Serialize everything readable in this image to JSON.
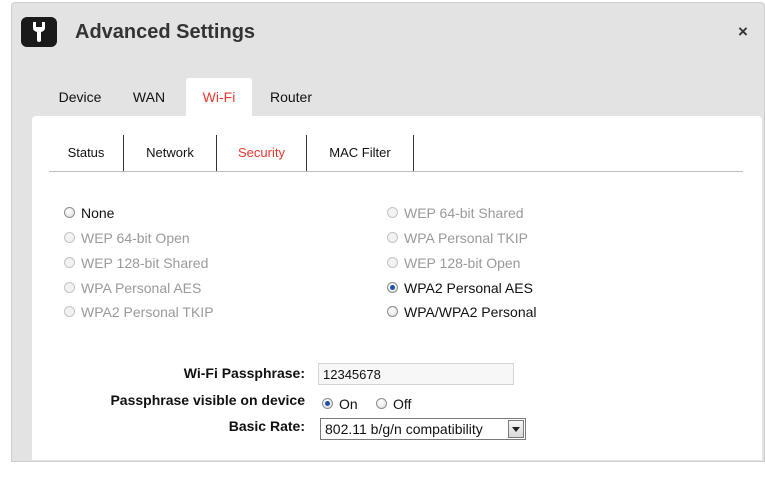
{
  "window": {
    "title": "Advanced Settings",
    "close_label": "×"
  },
  "icons": {
    "app": "wrench-icon",
    "close": "close-icon",
    "dropdown": "chevron-down-icon"
  },
  "main_tabs": [
    {
      "label": "Device",
      "active": false
    },
    {
      "label": "WAN",
      "active": false
    },
    {
      "label": "Wi-Fi",
      "active": true
    },
    {
      "label": "Router",
      "active": false
    }
  ],
  "sub_tabs": [
    {
      "label": "Status",
      "active": false
    },
    {
      "label": "Network",
      "active": false
    },
    {
      "label": "Security",
      "active": true
    },
    {
      "label": "MAC Filter",
      "active": false
    }
  ],
  "security_options": {
    "left": [
      {
        "label": "None",
        "enabled": true,
        "checked": false
      },
      {
        "label": "WEP 64-bit Open",
        "enabled": false,
        "checked": false
      },
      {
        "label": "WEP 128-bit Shared",
        "enabled": false,
        "checked": false
      },
      {
        "label": "WPA Personal AES",
        "enabled": false,
        "checked": false
      },
      {
        "label": "WPA2 Personal TKIP",
        "enabled": false,
        "checked": false
      }
    ],
    "right": [
      {
        "label": "WEP 64-bit Shared",
        "enabled": false,
        "checked": false
      },
      {
        "label": "WPA Personal TKIP",
        "enabled": false,
        "checked": false
      },
      {
        "label": "WEP 128-bit Open",
        "enabled": false,
        "checked": false
      },
      {
        "label": "WPA2 Personal AES",
        "enabled": true,
        "checked": true
      },
      {
        "label": "WPA/WPA2 Personal",
        "enabled": true,
        "checked": false
      }
    ]
  },
  "form": {
    "passphrase_label": "Wi-Fi Passphrase:",
    "passphrase_value": "12345678",
    "visible_label": "Passphrase visible on device",
    "visible_on": "On",
    "visible_off": "Off",
    "visible_selected": "On",
    "rate_label": "Basic Rate:",
    "rate_value": "802.11 b/g/n compatibility"
  },
  "colors": {
    "accent_red": "#e8372f",
    "frame_gray": "#e3e3e3",
    "disabled_text": "#9a9a9a",
    "radio_selected": "#1f4fa8"
  }
}
